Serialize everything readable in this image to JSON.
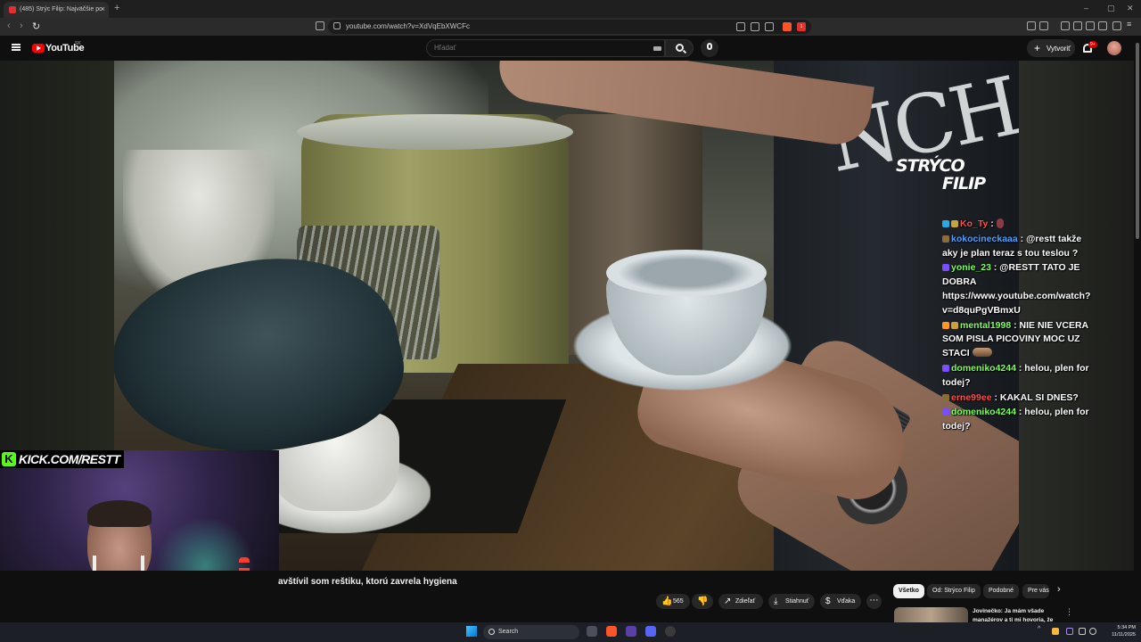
{
  "browser": {
    "tab_title": "(485) Strýc Filip: Najväčšie po",
    "tab_close": "×",
    "new_tab": "+",
    "url": "youtube.com/watch?v=XdVqEbXWCFc",
    "nav": {
      "back": "‹",
      "forward": "›",
      "reload": "↻"
    },
    "window_controls": {
      "minimize": "–",
      "maximize": "▢",
      "close": "✕"
    },
    "extension_badge": "1"
  },
  "youtube": {
    "logo_text": "YouTube",
    "region": "SK",
    "search_placeholder": "Hľadať",
    "create_label": "Vytvoriť",
    "create_plus": "+",
    "notifications_badge": "9+"
  },
  "video": {
    "watermark_line1": "STRÝCO",
    "watermark_line2": "FILIP",
    "shirt_text": "NCH",
    "title": "avštívil som reštiku, ktorú zavrela hygiena"
  },
  "chat": [
    {
      "user": "Ko_Ty",
      "color": "#ff4d4d",
      "text": "",
      "badges": [
        "#2aa9e0",
        "#c8a23c"
      ],
      "emote": "small"
    },
    {
      "user": "kokocineckaaa",
      "color": "#4aa3ff",
      "text": "@restt takže aky je plan teraz s tou teslou ?",
      "badges": [
        "#8a6d3b"
      ],
      "emote": ""
    },
    {
      "user": "yonie_23",
      "color": "#7dff5a",
      "text": "@RESTT TATO JE DOBRA https://www.youtube.com/watch?v=d8quPgVBmxU",
      "badges": [
        "#7a4dff"
      ],
      "emote": ""
    },
    {
      "user": "mental1998",
      "color": "#7dff5a",
      "text": "NIE NIE VCERA SOM PISLA PICOVINY MOC UZ STACI",
      "badges": [
        "#ff9a1f",
        "#c8a23c"
      ],
      "emote": "wide"
    },
    {
      "user": "domeniko4244",
      "color": "#7dff5a",
      "text": "helou, plen for todej?",
      "badges": [
        "#7a4dff"
      ],
      "emote": ""
    },
    {
      "user": "erne99ee",
      "color": "#ff4d4d",
      "text": "KAKAL SI DNES?",
      "badges": [
        "#8a6d3b"
      ],
      "emote": ""
    },
    {
      "user": "domeniko4244",
      "color": "#7dff5a",
      "text": "helou, plen for todej?",
      "badges": [
        "#7a4dff"
      ],
      "emote": ""
    }
  ],
  "webcam": {
    "kick_logo": "K",
    "kick_text": "KICK.COM/RESTT"
  },
  "actions": {
    "likes": "565",
    "like_icon": "👍",
    "dislike_icon": "👎",
    "share": "Zdieľať",
    "share_icon": "↗",
    "download": "Stiahnuť",
    "download_icon": "⤓",
    "thanks": "Vďaka",
    "thanks_icon": "$",
    "more": "⋯"
  },
  "chips": {
    "all": "Všetko",
    "channel": "Od: Strýco Filip",
    "similar": "Podobné",
    "for_you": "Pre vás",
    "next": "›"
  },
  "recommendation": {
    "title": "Jovinečko: Ja mám všade manažérov a ti mi hovoria, že",
    "menu": "⋮"
  },
  "taskbar": {
    "search_label": "Search",
    "time": "5:34 PM",
    "date": "11/11/2025"
  },
  "colors": {
    "yt_red": "#ff0000",
    "kick_green": "#53fc18"
  }
}
